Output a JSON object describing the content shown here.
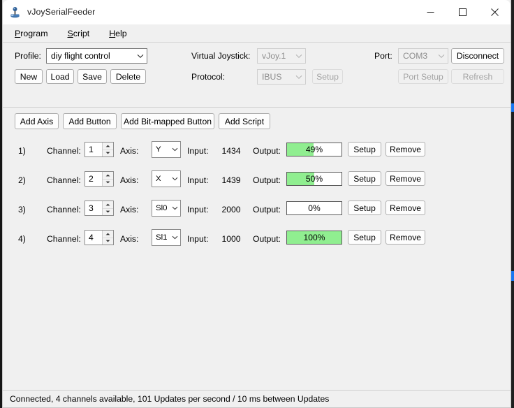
{
  "window": {
    "title": "vJoySerialFeeder",
    "icon": "joystick-icon",
    "minimize_label": "Minimize",
    "maximize_label": "Maximize",
    "close_label": "Close"
  },
  "menu": {
    "items": [
      {
        "label": "Program",
        "mnemonic": "P"
      },
      {
        "label": "Script",
        "mnemonic": "S"
      },
      {
        "label": "Help",
        "mnemonic": "H"
      }
    ]
  },
  "top_panel": {
    "profile_label": "Profile:",
    "profile_value": "diy flight control",
    "profile_buttons": [
      {
        "label": "New",
        "enabled": true
      },
      {
        "label": "Load",
        "enabled": true
      },
      {
        "label": "Save",
        "enabled": true
      },
      {
        "label": "Delete",
        "enabled": true
      }
    ],
    "virtual_joystick_label": "Virtual Joystick:",
    "virtual_joystick_value": "vJoy.1",
    "virtual_joystick_enabled": false,
    "protocol_label": "Protocol:",
    "protocol_value": "IBUS",
    "protocol_enabled": false,
    "protocol_setup_label": "Setup",
    "protocol_setup_enabled": false,
    "port_label": "Port:",
    "port_value": "COM3",
    "port_enabled": false,
    "connect_label": "Disconnect",
    "connect_enabled": true,
    "port_setup_label": "Port Setup",
    "port_setup_enabled": false,
    "refresh_label": "Refresh",
    "refresh_enabled": false
  },
  "toolbar": {
    "add_axis_label": "Add Axis",
    "add_button_label": "Add Button",
    "add_bitmapped_label": "Add Bit-mapped Button",
    "add_script_label": "Add Script"
  },
  "row_labels": {
    "channel": "Channel:",
    "axis": "Axis:",
    "input": "Input:",
    "output": "Output:",
    "setup": "Setup",
    "remove": "Remove"
  },
  "axis_rows": [
    {
      "index": "1)",
      "channel": "1",
      "axis": "Y",
      "input": "1434",
      "output_text": "49%",
      "output_pct": 49
    },
    {
      "index": "2)",
      "channel": "2",
      "axis": "X",
      "input": "1439",
      "output_text": "50%",
      "output_pct": 50
    },
    {
      "index": "3)",
      "channel": "3",
      "axis": "Sl0",
      "input": "2000",
      "output_text": "0%",
      "output_pct": 0
    },
    {
      "index": "4)",
      "channel": "4",
      "axis": "Sl1",
      "input": "1000",
      "output_text": "100%",
      "output_pct": 100
    }
  ],
  "status": {
    "text": "Connected, 4 channels available, 101 Updates per second / 10 ms between Updates"
  },
  "colors": {
    "bar_fill": "#90ee90",
    "window_bg": "#f0f0f0",
    "accent": "#1877f2"
  }
}
